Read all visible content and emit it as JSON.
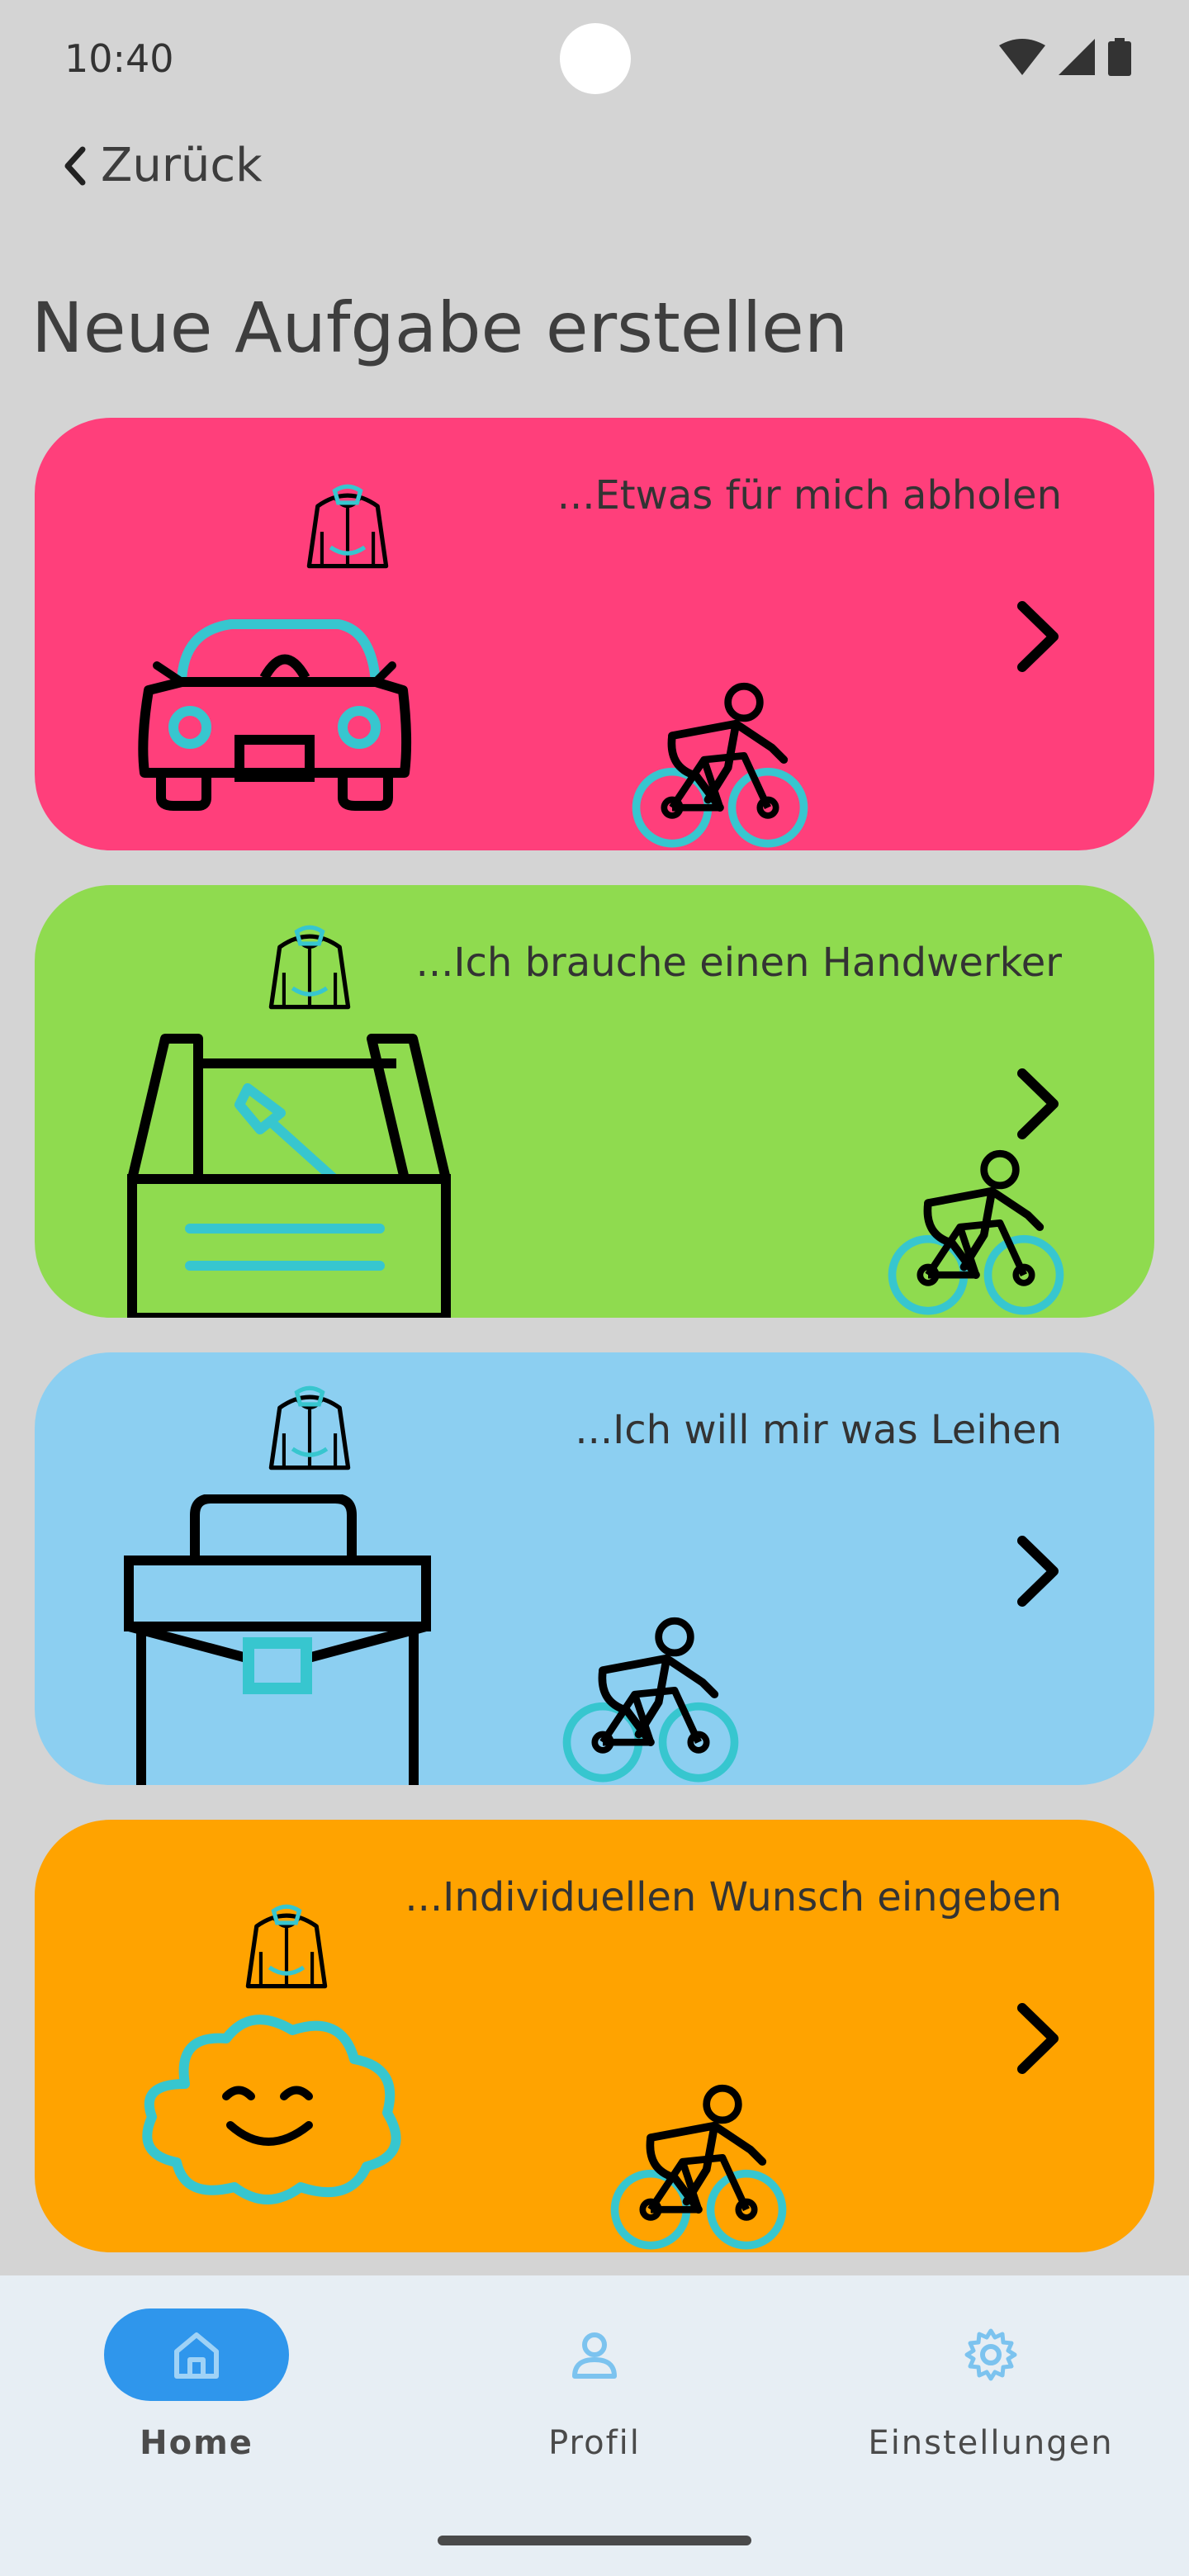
{
  "status_bar": {
    "time": "10:40"
  },
  "header": {
    "back_label": "Zurück",
    "title": "Neue Aufgabe erstellen"
  },
  "cards": [
    {
      "label": "...Etwas für mich abholen",
      "color": "#ff3f7b",
      "icon": "car-icon"
    },
    {
      "label": "...Ich brauche einen Handwerker",
      "color": "#8fdb4f",
      "icon": "toolbox-icon"
    },
    {
      "label": "...Ich will mir was Leihen",
      "color": "#8ccff1",
      "icon": "briefcase-icon"
    },
    {
      "label": "...Individuellen Wunsch eingeben",
      "color": "#ffa300",
      "icon": "cloud-smile-icon"
    }
  ],
  "bottom_nav": {
    "items": [
      {
        "label": "Home",
        "icon": "home-icon",
        "active": true
      },
      {
        "label": "Profil",
        "icon": "profile-icon",
        "active": false
      },
      {
        "label": "Einstellungen",
        "icon": "gear-icon",
        "active": false
      }
    ]
  },
  "colors": {
    "accent": "#2f96ec",
    "teal": "#37c6cf",
    "background": "#d4d4d4"
  }
}
